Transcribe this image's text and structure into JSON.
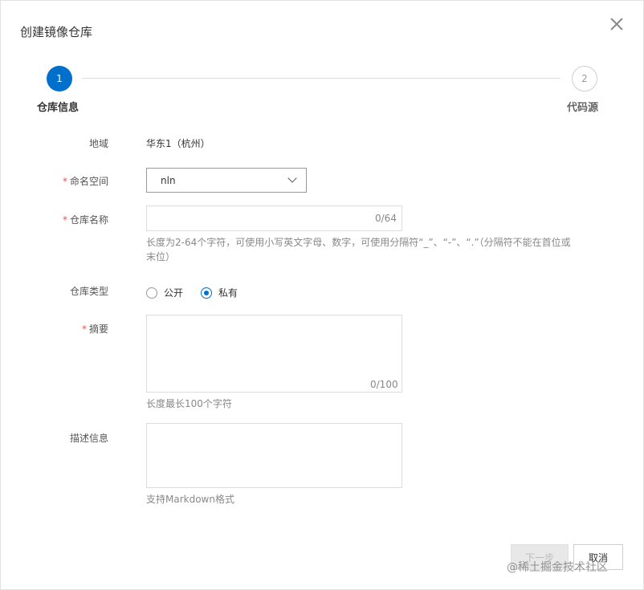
{
  "dialog": {
    "title": "创建镜像仓库"
  },
  "steps": [
    {
      "number": "1",
      "label": "仓库信息",
      "state": "active"
    },
    {
      "number": "2",
      "label": "代码源",
      "state": "inactive"
    }
  ],
  "form": {
    "region": {
      "label": "地域",
      "value": "华东1（杭州）"
    },
    "namespace": {
      "label": "命名空间",
      "required": "*",
      "value": "nln"
    },
    "repo_name": {
      "label": "仓库名称",
      "required": "*",
      "value": "",
      "counter": "0/64",
      "hint": "长度为2-64个字符，可使用小写英文字母、数字，可使用分隔符“_”、“-”、“.”（分隔符不能在首位或末位）"
    },
    "repo_type": {
      "label": "仓库类型",
      "options": [
        "公开",
        "私有"
      ],
      "selected": "私有"
    },
    "summary": {
      "label": "摘要",
      "required": "*",
      "value": "",
      "counter": "0/100",
      "hint": "长度最长100个字符"
    },
    "description": {
      "label": "描述信息",
      "value": "",
      "hint": "支持Markdown格式"
    }
  },
  "footer": {
    "next_label": "下一步",
    "cancel_label": "取消"
  },
  "watermark": "@稀土掘金技术社区",
  "colors": {
    "primary": "#0070cc",
    "required": "#e05555"
  }
}
